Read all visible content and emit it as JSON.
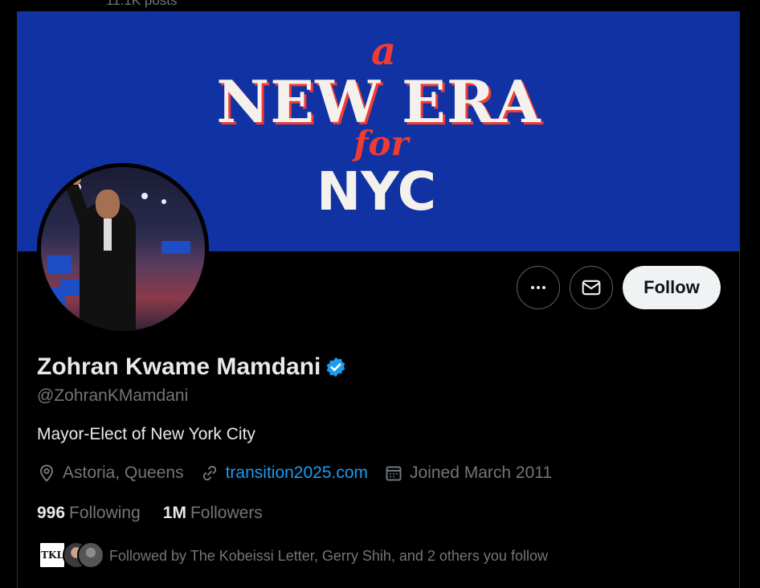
{
  "header": {
    "posts_label": "11.1K posts"
  },
  "banner": {
    "line_a": "a",
    "line_new_era": "NEW ERA",
    "line_for": "for",
    "line_nyc": "NYC"
  },
  "actions": {
    "follow_label": "Follow",
    "more_icon": "more-horizontal-icon",
    "message_icon": "envelope-icon"
  },
  "profile": {
    "name": "Zohran Kwame Mamdani",
    "verified": true,
    "verified_color": "#1d9bf0",
    "handle": "@ZohranKMamdani",
    "bio": "Mayor-Elect of New York City",
    "location": "Astoria, Queens",
    "website": "transition2025.com",
    "joined": "Joined March 2011"
  },
  "stats": {
    "following_count": "996",
    "following_label": "Following",
    "followers_count": "1M",
    "followers_label": "Followers"
  },
  "followed_by": {
    "text": "Followed by The Kobeissi Letter, Gerry Shih, and 2 others you follow",
    "avatar1_label": "TKL"
  },
  "colors": {
    "link": "#1d9bf0",
    "banner_bg": "#1132a3",
    "banner_accent": "#ef3b34"
  }
}
